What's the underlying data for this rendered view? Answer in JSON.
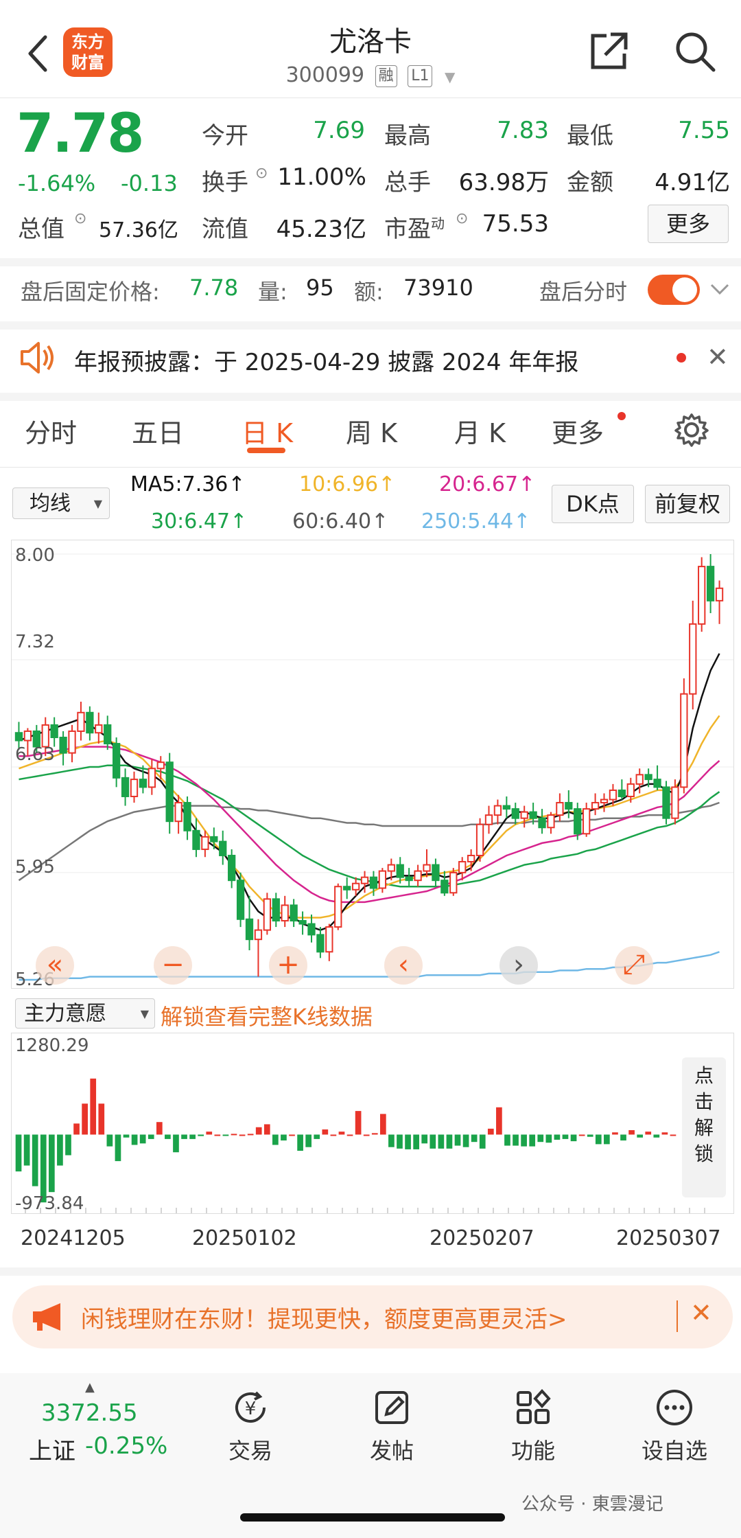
{
  "header": {
    "logo_text": "东方\n财富",
    "title": "尤洛卡",
    "code": "300099",
    "tags": [
      "融",
      "L1"
    ]
  },
  "quote": {
    "price": "7.78",
    "change_pct": "-1.64%",
    "change": "-0.13",
    "open_label": "今开",
    "open": "7.69",
    "high_label": "最高",
    "high": "7.83",
    "low_label": "最低",
    "low": "7.55",
    "turnover_label": "换手",
    "turnover": "11.00%",
    "volume_label": "总手",
    "volume": "63.98万",
    "amount_label": "金额",
    "amount": "4.91亿",
    "mktcap_label": "总值",
    "mktcap": "57.36亿",
    "float_label": "流值",
    "float": "45.23亿",
    "pe_label": "市盈",
    "pe_sup": "动",
    "pe": "75.53",
    "more": "更多"
  },
  "after_hours": {
    "label": "盘后固定价格:",
    "price": "7.78",
    "vol_label": "量:",
    "vol": "95",
    "amt_label": "额:",
    "amt": "73910",
    "tick_label": "盘后分时",
    "toggle_on": true
  },
  "notice": {
    "text": "年报预披露：于 2025-04-29 披露 2024 年年报"
  },
  "tabs": [
    {
      "label": "分时"
    },
    {
      "label": "五日"
    },
    {
      "label": "日 K",
      "active": true
    },
    {
      "label": "周 K"
    },
    {
      "label": "月 K"
    },
    {
      "label": "更多"
    }
  ],
  "ma": {
    "selector": "均线",
    "ma5": "MA5:7.36↑",
    "ma10": "10:6.96↑",
    "ma20": "20:6.67↑",
    "ma30": "30:6.47↑",
    "ma60": "60:6.40↑",
    "ma250": "250:5.44↑",
    "dk_button": "DK点",
    "adjust_button": "前复权",
    "colors": {
      "ma5": "#111111",
      "ma10": "#f0b429",
      "ma20": "#d6248e",
      "ma30": "#1aa34a",
      "ma60": "#777777",
      "ma250": "#6fb8e6"
    }
  },
  "chart_data": {
    "type": "candlestick",
    "y_ticks": [
      "8.00",
      "7.32",
      "6.63",
      "5.95",
      "5.26"
    ],
    "ylim": [
      5.26,
      8.0
    ],
    "x_labels": [
      "20241205",
      "20250102",
      "20250207",
      "20250307"
    ],
    "candles": [
      [
        6.85,
        6.92,
        6.74,
        6.8
      ],
      [
        6.8,
        6.88,
        6.7,
        6.86
      ],
      [
        6.86,
        6.9,
        6.72,
        6.76
      ],
      [
        6.76,
        6.95,
        6.7,
        6.9
      ],
      [
        6.9,
        6.95,
        6.76,
        6.82
      ],
      [
        6.82,
        6.86,
        6.64,
        6.72
      ],
      [
        6.72,
        6.9,
        6.66,
        6.86
      ],
      [
        6.86,
        7.05,
        6.8,
        6.98
      ],
      [
        6.98,
        7.02,
        6.8,
        6.85
      ],
      [
        6.85,
        6.98,
        6.78,
        6.9
      ],
      [
        6.9,
        6.96,
        6.74,
        6.78
      ],
      [
        6.78,
        6.82,
        6.5,
        6.56
      ],
      [
        6.56,
        6.62,
        6.38,
        6.44
      ],
      [
        6.44,
        6.6,
        6.4,
        6.55
      ],
      [
        6.55,
        6.64,
        6.46,
        6.5
      ],
      [
        6.5,
        6.68,
        6.45,
        6.62
      ],
      [
        6.62,
        6.7,
        6.55,
        6.66
      ],
      [
        6.66,
        6.72,
        6.2,
        6.28
      ],
      [
        6.28,
        6.45,
        6.2,
        6.4
      ],
      [
        6.4,
        6.44,
        6.16,
        6.22
      ],
      [
        6.22,
        6.3,
        6.05,
        6.1
      ],
      [
        6.1,
        6.22,
        6.05,
        6.18
      ],
      [
        6.18,
        6.24,
        6.1,
        6.15
      ],
      [
        6.15,
        6.22,
        6.0,
        6.06
      ],
      [
        6.06,
        6.1,
        5.85,
        5.9
      ],
      [
        5.9,
        5.95,
        5.6,
        5.65
      ],
      [
        5.65,
        5.8,
        5.45,
        5.52
      ],
      [
        5.52,
        5.65,
        5.28,
        5.58
      ],
      [
        5.58,
        5.82,
        5.55,
        5.78
      ],
      [
        5.78,
        5.82,
        5.6,
        5.64
      ],
      [
        5.64,
        5.8,
        5.6,
        5.74
      ],
      [
        5.74,
        5.78,
        5.6,
        5.64
      ],
      [
        5.64,
        5.7,
        5.55,
        5.62
      ],
      [
        5.62,
        5.68,
        5.5,
        5.55
      ],
      [
        5.55,
        5.6,
        5.4,
        5.44
      ],
      [
        5.44,
        5.62,
        5.38,
        5.6
      ],
      [
        5.6,
        5.88,
        5.58,
        5.86
      ],
      [
        5.86,
        5.92,
        5.78,
        5.84
      ],
      [
        5.84,
        5.92,
        5.8,
        5.88
      ],
      [
        5.88,
        5.96,
        5.82,
        5.92
      ],
      [
        5.92,
        5.96,
        5.8,
        5.85
      ],
      [
        5.85,
        5.98,
        5.82,
        5.96
      ],
      [
        5.96,
        6.04,
        5.9,
        6.0
      ],
      [
        6.0,
        6.05,
        5.88,
        5.92
      ],
      [
        5.92,
        5.98,
        5.86,
        5.9
      ],
      [
        5.9,
        6.0,
        5.86,
        5.96
      ],
      [
        5.96,
        6.1,
        5.92,
        6.0
      ],
      [
        6.0,
        6.04,
        5.86,
        5.9
      ],
      [
        5.9,
        5.96,
        5.8,
        5.82
      ],
      [
        5.82,
        5.98,
        5.8,
        5.95
      ],
      [
        5.95,
        6.05,
        5.9,
        6.02
      ],
      [
        6.02,
        6.1,
        5.96,
        6.06
      ],
      [
        6.06,
        6.3,
        6.02,
        6.26
      ],
      [
        6.26,
        6.38,
        6.2,
        6.32
      ],
      [
        6.32,
        6.42,
        6.26,
        6.38
      ],
      [
        6.38,
        6.44,
        6.3,
        6.36
      ],
      [
        6.36,
        6.4,
        6.26,
        6.3
      ],
      [
        6.3,
        6.38,
        6.24,
        6.34
      ],
      [
        6.34,
        6.4,
        6.26,
        6.3
      ],
      [
        6.3,
        6.36,
        6.2,
        6.24
      ],
      [
        6.24,
        6.34,
        6.2,
        6.32
      ],
      [
        6.32,
        6.46,
        6.28,
        6.4
      ],
      [
        6.4,
        6.48,
        6.3,
        6.36
      ],
      [
        6.36,
        6.4,
        6.16,
        6.2
      ],
      [
        6.2,
        6.4,
        6.18,
        6.36
      ],
      [
        6.36,
        6.46,
        6.32,
        6.4
      ],
      [
        6.4,
        6.46,
        6.34,
        6.42
      ],
      [
        6.42,
        6.52,
        6.38,
        6.48
      ],
      [
        6.48,
        6.55,
        6.42,
        6.44
      ],
      [
        6.44,
        6.56,
        6.4,
        6.52
      ],
      [
        6.52,
        6.62,
        6.46,
        6.58
      ],
      [
        6.58,
        6.62,
        6.5,
        6.55
      ],
      [
        6.55,
        6.64,
        6.48,
        6.5
      ],
      [
        6.5,
        6.54,
        6.26,
        6.3
      ],
      [
        6.3,
        6.55,
        6.26,
        6.5
      ],
      [
        6.5,
        7.2,
        6.46,
        7.1
      ],
      [
        7.1,
        7.7,
        7.0,
        7.55
      ],
      [
        7.55,
        7.98,
        7.5,
        7.92
      ],
      [
        7.92,
        8.0,
        7.62,
        7.7
      ],
      [
        7.7,
        7.83,
        7.55,
        7.78
      ]
    ],
    "ma5": [
      6.8,
      6.82,
      6.84,
      6.86,
      6.88,
      6.9,
      6.92,
      6.94,
      6.9,
      6.86,
      6.82,
      6.74,
      6.66,
      6.62,
      6.6,
      6.58,
      6.54,
      6.46,
      6.4,
      6.3,
      6.22,
      6.16,
      6.12,
      6.08,
      6.0,
      5.9,
      5.78,
      5.7,
      5.66,
      5.66,
      5.66,
      5.66,
      5.62,
      5.6,
      5.58,
      5.6,
      5.66,
      5.74,
      5.8,
      5.86,
      5.88,
      5.9,
      5.92,
      5.93,
      5.93,
      5.93,
      5.94,
      5.94,
      5.92,
      5.93,
      5.95,
      5.98,
      6.06,
      6.14,
      6.22,
      6.3,
      6.34,
      6.34,
      6.32,
      6.3,
      6.3,
      6.32,
      6.34,
      6.32,
      6.34,
      6.36,
      6.38,
      6.4,
      6.42,
      6.46,
      6.5,
      6.52,
      6.52,
      6.48,
      6.46,
      6.6,
      6.88,
      7.08,
      7.25,
      7.36
    ],
    "ma10": [
      6.62,
      6.64,
      6.66,
      6.68,
      6.7,
      6.72,
      6.74,
      6.76,
      6.78,
      6.79,
      6.8,
      6.78,
      6.76,
      6.72,
      6.68,
      6.62,
      6.56,
      6.5,
      6.44,
      6.38,
      6.3,
      6.22,
      6.14,
      6.08,
      6.0,
      5.94,
      5.86,
      5.8,
      5.74,
      5.7,
      5.68,
      5.66,
      5.66,
      5.66,
      5.66,
      5.67,
      5.69,
      5.72,
      5.76,
      5.8,
      5.83,
      5.86,
      5.88,
      5.9,
      5.91,
      5.92,
      5.93,
      5.94,
      5.95,
      5.96,
      5.97,
      6.0,
      6.04,
      6.1,
      6.16,
      6.22,
      6.26,
      6.28,
      6.3,
      6.31,
      6.32,
      6.33,
      6.34,
      6.34,
      6.35,
      6.36,
      6.37,
      6.38,
      6.4,
      6.42,
      6.44,
      6.46,
      6.48,
      6.48,
      6.5,
      6.56,
      6.66,
      6.78,
      6.88,
      6.96
    ],
    "ma20": [
      6.7,
      6.7,
      6.71,
      6.72,
      6.73,
      6.74,
      6.75,
      6.76,
      6.76,
      6.76,
      6.76,
      6.75,
      6.74,
      6.72,
      6.7,
      6.68,
      6.66,
      6.63,
      6.6,
      6.56,
      6.52,
      6.47,
      6.42,
      6.36,
      6.3,
      6.24,
      6.18,
      6.12,
      6.06,
      6.0,
      5.95,
      5.9,
      5.86,
      5.82,
      5.79,
      5.77,
      5.76,
      5.76,
      5.76,
      5.76,
      5.77,
      5.78,
      5.79,
      5.8,
      5.81,
      5.82,
      5.83,
      5.85,
      5.87,
      5.89,
      5.91,
      5.94,
      5.97,
      6.0,
      6.03,
      6.06,
      6.08,
      6.1,
      6.12,
      6.14,
      6.15,
      6.16,
      6.18,
      6.19,
      6.21,
      6.23,
      6.25,
      6.27,
      6.29,
      6.31,
      6.33,
      6.35,
      6.37,
      6.38,
      6.4,
      6.44,
      6.5,
      6.56,
      6.62,
      6.67
    ],
    "ma30": [
      6.55,
      6.56,
      6.57,
      6.58,
      6.59,
      6.6,
      6.61,
      6.62,
      6.63,
      6.63,
      6.64,
      6.64,
      6.64,
      6.63,
      6.62,
      6.61,
      6.6,
      6.58,
      6.56,
      6.54,
      6.51,
      6.48,
      6.45,
      6.42,
      6.38,
      6.34,
      6.3,
      6.26,
      6.22,
      6.18,
      6.14,
      6.1,
      6.06,
      6.03,
      6.0,
      5.97,
      5.95,
      5.93,
      5.91,
      5.9,
      5.89,
      5.88,
      5.87,
      5.86,
      5.86,
      5.86,
      5.86,
      5.86,
      5.86,
      5.87,
      5.88,
      5.89,
      5.9,
      5.92,
      5.94,
      5.96,
      5.98,
      6.0,
      6.01,
      6.02,
      6.04,
      6.05,
      6.06,
      6.07,
      6.09,
      6.1,
      6.12,
      6.14,
      6.16,
      6.18,
      6.2,
      6.22,
      6.24,
      6.25,
      6.27,
      6.3,
      6.34,
      6.38,
      6.43,
      6.47
    ],
    "ma60": [
      5.9,
      5.94,
      5.98,
      6.02,
      6.06,
      6.1,
      6.14,
      6.18,
      6.22,
      6.25,
      6.28,
      6.3,
      6.32,
      6.34,
      6.35,
      6.36,
      6.37,
      6.38,
      6.38,
      6.38,
      6.38,
      6.38,
      6.38,
      6.37,
      6.37,
      6.36,
      6.36,
      6.35,
      6.35,
      6.34,
      6.33,
      6.32,
      6.31,
      6.3,
      6.3,
      6.29,
      6.28,
      6.27,
      6.27,
      6.26,
      6.26,
      6.25,
      6.25,
      6.25,
      6.25,
      6.25,
      6.25,
      6.25,
      6.25,
      6.25,
      6.25,
      6.26,
      6.26,
      6.26,
      6.27,
      6.27,
      6.27,
      6.27,
      6.28,
      6.28,
      6.28,
      6.28,
      6.28,
      6.29,
      6.29,
      6.29,
      6.3,
      6.3,
      6.3,
      6.31,
      6.31,
      6.32,
      6.32,
      6.32,
      6.33,
      6.34,
      6.35,
      6.37,
      6.38,
      6.4
    ],
    "ma250": [
      5.26,
      5.26,
      5.26,
      5.27,
      5.27,
      5.27,
      5.27,
      5.27,
      5.28,
      5.28,
      5.28,
      5.28,
      5.28,
      5.28,
      5.28,
      5.28,
      5.28,
      5.28,
      5.28,
      5.28,
      5.28,
      5.28,
      5.28,
      5.28,
      5.28,
      5.28,
      5.28,
      5.28,
      5.28,
      5.28,
      5.28,
      5.28,
      5.28,
      5.28,
      5.28,
      5.28,
      5.28,
      5.28,
      5.28,
      5.28,
      5.28,
      5.28,
      5.28,
      5.28,
      5.28,
      5.28,
      5.29,
      5.29,
      5.29,
      5.29,
      5.29,
      5.29,
      5.29,
      5.3,
      5.3,
      5.3,
      5.3,
      5.31,
      5.31,
      5.31,
      5.31,
      5.32,
      5.32,
      5.32,
      5.33,
      5.33,
      5.33,
      5.34,
      5.34,
      5.35,
      5.35,
      5.36,
      5.37,
      5.37,
      5.38,
      5.39,
      5.4,
      5.41,
      5.42,
      5.44
    ],
    "sub": {
      "label": "主力意愿",
      "unlock_text": "解锁查看完整K线数据",
      "y_top": "1280.29",
      "y_bottom": "-973.84",
      "ylim": [
        -973.84,
        1280.29
      ],
      "values": [
        -500,
        -420,
        -700,
        -920,
        -780,
        -420,
        -280,
        150,
        420,
        760,
        420,
        -160,
        -360,
        -40,
        -140,
        -120,
        -60,
        170,
        -60,
        -240,
        -60,
        -60,
        -20,
        40,
        0,
        -10,
        10,
        0,
        10,
        100,
        140,
        -140,
        -80,
        0,
        -220,
        -170,
        -60,
        70,
        0,
        40,
        0,
        320,
        0,
        20,
        280,
        -170,
        -190,
        -200,
        -200,
        -120,
        -190,
        -190,
        -190,
        -150,
        -170,
        -100,
        -190,
        80,
        370,
        -150,
        -150,
        -160,
        -160,
        -100,
        -110,
        -70,
        -60,
        -90,
        0,
        -30,
        -130,
        -130,
        30,
        -80,
        60,
        -40,
        40,
        -40,
        30,
        0
      ]
    }
  },
  "chart_controls": [
    "«",
    "−",
    "+",
    "‹",
    "›",
    "⤢"
  ],
  "unlock_side": "点\n击\n解\n锁",
  "banner": {
    "text": "闲钱理财在东财！提现更快，额度更高更灵活>"
  },
  "bottom": {
    "index_value": "3372.55",
    "index_name": "上证",
    "index_change": "-0.25%",
    "nav": [
      {
        "label": "交易",
        "icon": "yen-icon"
      },
      {
        "label": "发帖",
        "icon": "edit-icon"
      },
      {
        "label": "功能",
        "icon": "grid-icon"
      },
      {
        "label": "设自选",
        "icon": "more-icon"
      }
    ],
    "watermark": "公众号 · 東雲漫记"
  }
}
